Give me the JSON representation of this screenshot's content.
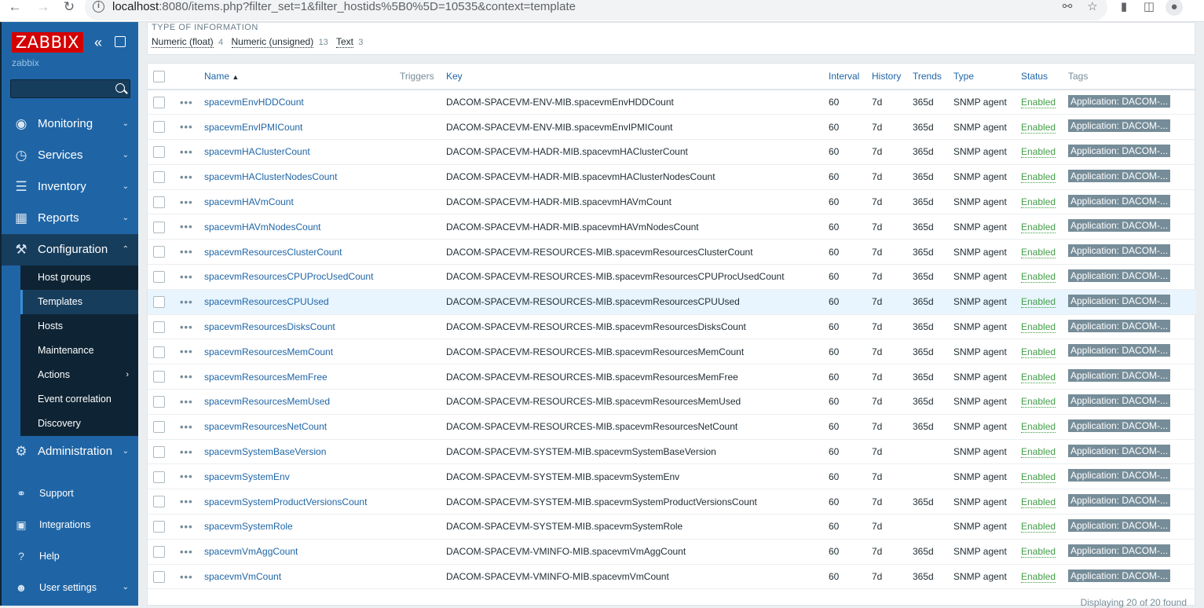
{
  "browser": {
    "url_host": "localhost",
    "url_rest": ":8080/items.php?filter_set=1&filter_hostids%5B0%5D=10535&context=template"
  },
  "sidebar": {
    "logo": "ZABBIX",
    "server_name": "zabbix",
    "menu": [
      {
        "label": "Monitoring",
        "icon": "eye-icon"
      },
      {
        "label": "Services",
        "icon": "clock-icon"
      },
      {
        "label": "Inventory",
        "icon": "list-icon"
      },
      {
        "label": "Reports",
        "icon": "bar-chart-icon"
      },
      {
        "label": "Configuration",
        "icon": "wrench-icon"
      }
    ],
    "submenu": [
      {
        "label": "Host groups"
      },
      {
        "label": "Templates"
      },
      {
        "label": "Hosts"
      },
      {
        "label": "Maintenance"
      },
      {
        "label": "Actions"
      },
      {
        "label": "Event correlation"
      },
      {
        "label": "Discovery"
      }
    ],
    "administration": "Administration",
    "lower": [
      {
        "label": "Support",
        "icon": "headset-icon"
      },
      {
        "label": "Integrations",
        "icon": "integrations-icon"
      },
      {
        "label": "Help",
        "icon": "help-icon"
      },
      {
        "label": "User settings",
        "icon": "user-icon"
      }
    ]
  },
  "filter": {
    "title": "TYPE OF INFORMATION",
    "facets": [
      {
        "label": "Numeric (float)",
        "count": "4"
      },
      {
        "label": "Numeric (unsigned)",
        "count": "13"
      },
      {
        "label": "Text",
        "count": "3"
      }
    ]
  },
  "table": {
    "columns": {
      "name": "Name",
      "triggers": "Triggers",
      "key": "Key",
      "interval": "Interval",
      "history": "History",
      "trends": "Trends",
      "type": "Type",
      "status": "Status",
      "tags": "Tags"
    },
    "rows": [
      {
        "name": "spacevmEnvHDDCount",
        "key": "DACOM-SPACEVM-ENV-MIB.spacevmEnvHDDCount",
        "interval": "60",
        "history": "7d",
        "trends": "365d",
        "type": "SNMP agent",
        "status": "Enabled",
        "tag": "Application: DACOM-..."
      },
      {
        "name": "spacevmEnvIPMICount",
        "key": "DACOM-SPACEVM-ENV-MIB.spacevmEnvIPMICount",
        "interval": "60",
        "history": "7d",
        "trends": "365d",
        "type": "SNMP agent",
        "status": "Enabled",
        "tag": "Application: DACOM-..."
      },
      {
        "name": "spacevmHAClusterCount",
        "key": "DACOM-SPACEVM-HADR-MIB.spacevmHAClusterCount",
        "interval": "60",
        "history": "7d",
        "trends": "365d",
        "type": "SNMP agent",
        "status": "Enabled",
        "tag": "Application: DACOM-..."
      },
      {
        "name": "spacevmHAClusterNodesCount",
        "key": "DACOM-SPACEVM-HADR-MIB.spacevmHAClusterNodesCount",
        "interval": "60",
        "history": "7d",
        "trends": "365d",
        "type": "SNMP agent",
        "status": "Enabled",
        "tag": "Application: DACOM-..."
      },
      {
        "name": "spacevmHAVmCount",
        "key": "DACOM-SPACEVM-HADR-MIB.spacevmHAVmCount",
        "interval": "60",
        "history": "7d",
        "trends": "365d",
        "type": "SNMP agent",
        "status": "Enabled",
        "tag": "Application: DACOM-..."
      },
      {
        "name": "spacevmHAVmNodesCount",
        "key": "DACOM-SPACEVM-HADR-MIB.spacevmHAVmNodesCount",
        "interval": "60",
        "history": "7d",
        "trends": "365d",
        "type": "SNMP agent",
        "status": "Enabled",
        "tag": "Application: DACOM-..."
      },
      {
        "name": "spacevmResourcesClusterCount",
        "key": "DACOM-SPACEVM-RESOURCES-MIB.spacevmResourcesClusterCount",
        "interval": "60",
        "history": "7d",
        "trends": "365d",
        "type": "SNMP agent",
        "status": "Enabled",
        "tag": "Application: DACOM-..."
      },
      {
        "name": "spacevmResourcesCPUProcUsedCount",
        "key": "DACOM-SPACEVM-RESOURCES-MIB.spacevmResourcesCPUProcUsedCount",
        "interval": "60",
        "history": "7d",
        "trends": "365d",
        "type": "SNMP agent",
        "status": "Enabled",
        "tag": "Application: DACOM-..."
      },
      {
        "name": "spacevmResourcesCPUUsed",
        "key": "DACOM-SPACEVM-RESOURCES-MIB.spacevmResourcesCPUUsed",
        "interval": "60",
        "history": "7d",
        "trends": "365d",
        "type": "SNMP agent",
        "status": "Enabled",
        "tag": "Application: DACOM-...",
        "highlight": true
      },
      {
        "name": "spacevmResourcesDisksCount",
        "key": "DACOM-SPACEVM-RESOURCES-MIB.spacevmResourcesDisksCount",
        "interval": "60",
        "history": "7d",
        "trends": "365d",
        "type": "SNMP agent",
        "status": "Enabled",
        "tag": "Application: DACOM-..."
      },
      {
        "name": "spacevmResourcesMemCount",
        "key": "DACOM-SPACEVM-RESOURCES-MIB.spacevmResourcesMemCount",
        "interval": "60",
        "history": "7d",
        "trends": "365d",
        "type": "SNMP agent",
        "status": "Enabled",
        "tag": "Application: DACOM-..."
      },
      {
        "name": "spacevmResourcesMemFree",
        "key": "DACOM-SPACEVM-RESOURCES-MIB.spacevmResourcesMemFree",
        "interval": "60",
        "history": "7d",
        "trends": "365d",
        "type": "SNMP agent",
        "status": "Enabled",
        "tag": "Application: DACOM-..."
      },
      {
        "name": "spacevmResourcesMemUsed",
        "key": "DACOM-SPACEVM-RESOURCES-MIB.spacevmResourcesMemUsed",
        "interval": "60",
        "history": "7d",
        "trends": "365d",
        "type": "SNMP agent",
        "status": "Enabled",
        "tag": "Application: DACOM-..."
      },
      {
        "name": "spacevmResourcesNetCount",
        "key": "DACOM-SPACEVM-RESOURCES-MIB.spacevmResourcesNetCount",
        "interval": "60",
        "history": "7d",
        "trends": "365d",
        "type": "SNMP agent",
        "status": "Enabled",
        "tag": "Application: DACOM-..."
      },
      {
        "name": "spacevmSystemBaseVersion",
        "key": "DACOM-SPACEVM-SYSTEM-MIB.spacevmSystemBaseVersion",
        "interval": "60",
        "history": "7d",
        "trends": "",
        "type": "SNMP agent",
        "status": "Enabled",
        "tag": "Application: DACOM-..."
      },
      {
        "name": "spacevmSystemEnv",
        "key": "DACOM-SPACEVM-SYSTEM-MIB.spacevmSystemEnv",
        "interval": "60",
        "history": "7d",
        "trends": "",
        "type": "SNMP agent",
        "status": "Enabled",
        "tag": "Application: DACOM-..."
      },
      {
        "name": "spacevmSystemProductVersionsCount",
        "key": "DACOM-SPACEVM-SYSTEM-MIB.spacevmSystemProductVersionsCount",
        "interval": "60",
        "history": "7d",
        "trends": "365d",
        "type": "SNMP agent",
        "status": "Enabled",
        "tag": "Application: DACOM-..."
      },
      {
        "name": "spacevmSystemRole",
        "key": "DACOM-SPACEVM-SYSTEM-MIB.spacevmSystemRole",
        "interval": "60",
        "history": "7d",
        "trends": "",
        "type": "SNMP agent",
        "status": "Enabled",
        "tag": "Application: DACOM-..."
      },
      {
        "name": "spacevmVmAggCount",
        "key": "DACOM-SPACEVM-VMINFO-MIB.spacevmVmAggCount",
        "interval": "60",
        "history": "7d",
        "trends": "365d",
        "type": "SNMP agent",
        "status": "Enabled",
        "tag": "Application: DACOM-..."
      },
      {
        "name": "spacevmVmCount",
        "key": "DACOM-SPACEVM-VMINFO-MIB.spacevmVmCount",
        "interval": "60",
        "history": "7d",
        "trends": "365d",
        "type": "SNMP agent",
        "status": "Enabled",
        "tag": "Application: DACOM-..."
      }
    ],
    "footer": "Displaying 20 of 20 found"
  }
}
